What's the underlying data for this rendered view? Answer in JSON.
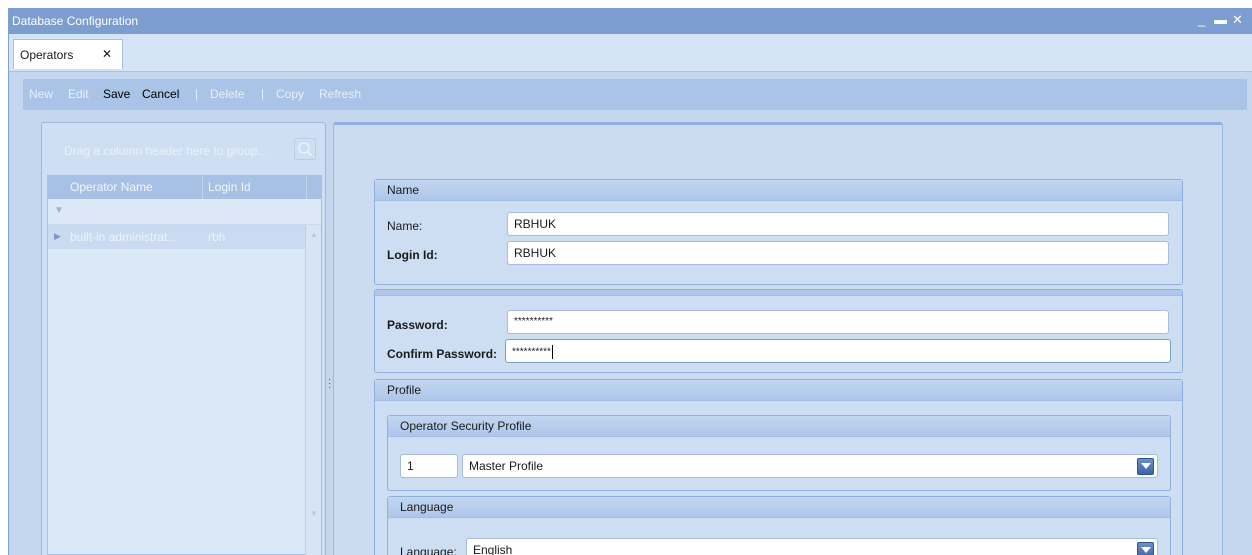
{
  "window": {
    "title": "Database Configuration",
    "controls": [
      "minimize-icon",
      "maximize-icon",
      "close-icon"
    ]
  },
  "tabs": [
    {
      "label": "Operators",
      "close": "✕"
    }
  ],
  "toolbar": {
    "new": "New",
    "edit": "Edit",
    "save": "Save",
    "cancel": "Cancel",
    "sep": "|",
    "delete": "Delete",
    "copy": "Copy",
    "refresh": "Refresh"
  },
  "grid": {
    "group_hint": "Drag a column header here to group...",
    "columns": [
      "Operator Name",
      "Login Id"
    ],
    "rows": [
      {
        "operator_name": "built-in administrat...",
        "login_id": "rbh"
      }
    ]
  },
  "name_group": {
    "title": "Name",
    "name_label": "Name:",
    "name_value": "RBHUK",
    "login_label": "Login Id:",
    "login_value": "RBHUK"
  },
  "password_group": {
    "password_label": "Password:",
    "password_value": "**********",
    "confirm_label": "Confirm Password:",
    "confirm_value": "**********"
  },
  "profile_group": {
    "title": "Profile",
    "security": {
      "title": "Operator Security Profile",
      "id_value": "1",
      "selected": "Master Profile"
    },
    "language": {
      "title": "Language",
      "label": "Language:",
      "selected": "English"
    }
  },
  "colors": {
    "titlebar": "#7b9dd0",
    "toolbar": "#a9c4e7",
    "panel": "#cbdcf1",
    "dropdown_button": "#3d64a8"
  }
}
